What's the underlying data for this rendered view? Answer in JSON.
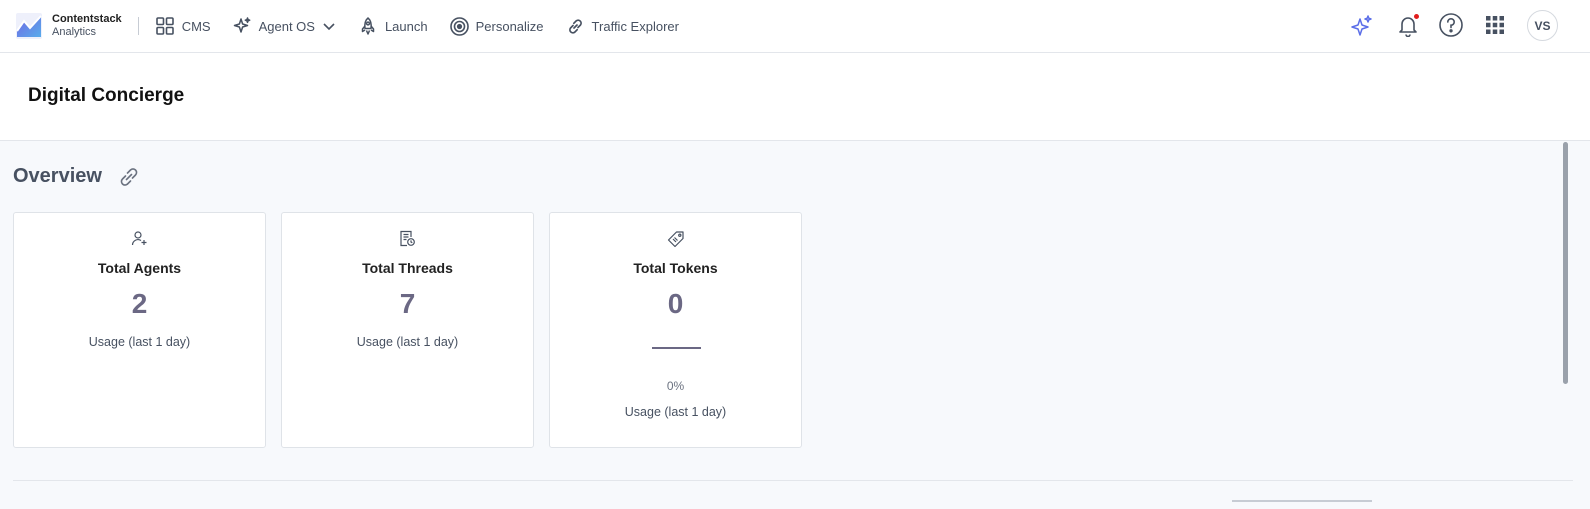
{
  "brand": {
    "name": "Contentstack",
    "sub": "Analytics"
  },
  "nav": [
    {
      "label": "CMS",
      "icon": "grid-icon"
    },
    {
      "label": "Agent OS",
      "icon": "sparkle-icon",
      "has_dropdown": true
    },
    {
      "label": "Launch",
      "icon": "rocket-icon"
    },
    {
      "label": "Personalize",
      "icon": "target-icon"
    },
    {
      "label": "Traffic Explorer",
      "icon": "link-icon"
    }
  ],
  "user": {
    "initials": "VS"
  },
  "page": {
    "title": "Digital Concierge"
  },
  "overview": {
    "title": "Overview",
    "cards": [
      {
        "title": "Total Agents",
        "value": "2",
        "sub": "Usage (last 1 day)",
        "icon": "user-add-icon"
      },
      {
        "title": "Total Threads",
        "value": "7",
        "sub": "Usage (last 1 day)",
        "icon": "thread-icon"
      },
      {
        "title": "Total Tokens",
        "value": "0",
        "pct": "0%",
        "sub": "Usage (last 1 day)",
        "icon": "tag-icon"
      }
    ]
  },
  "colors": {
    "accent": "#6c5ce7",
    "value": "#6b6884",
    "notification": "#e11d1d"
  }
}
